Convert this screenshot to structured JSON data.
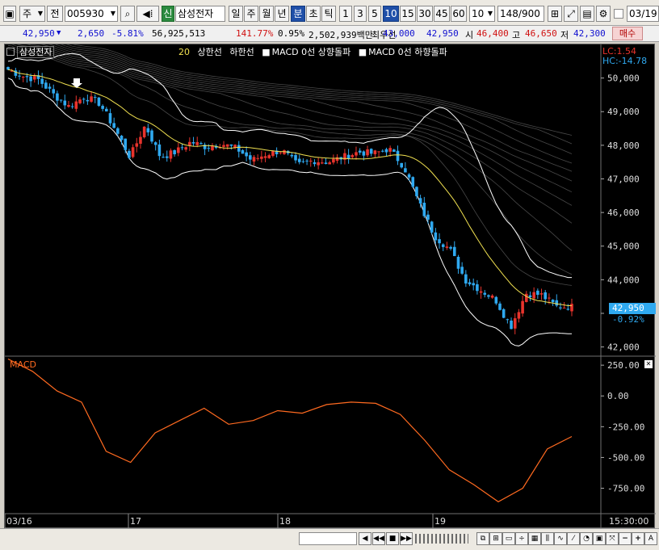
{
  "toolbar": {
    "period_select": "주",
    "prev_label": "전",
    "stock_code": "005930",
    "badge": "신",
    "stock_name": "삼성전자",
    "periods": [
      "일",
      "주",
      "월",
      "년",
      "분",
      "초",
      "틱"
    ],
    "active_period": "분",
    "intervals": [
      "1",
      "3",
      "5",
      "10",
      "15",
      "30",
      "45",
      "60"
    ],
    "active_interval": "10",
    "interval_select": "10",
    "count": "148",
    "total": "/900",
    "date": "03/19"
  },
  "infobar": {
    "price": "42,950",
    "change": "2,650",
    "change_pct": "-5.81%",
    "volume": "56,925,513",
    "vol_ratio": "141.77%",
    "turnover": "0.95%",
    "amount": "2,502,939백만",
    "label_best": "최우선",
    "ask": "43,000",
    "bid": "42,950",
    "open_label": "시",
    "open": "46,400",
    "high_label": "고",
    "high": "46,650",
    "low_label": "저",
    "low": "42,300",
    "buy_button": "매수"
  },
  "legend": {
    "stock_label": "삼성전자",
    "ma_text": "20",
    "upper": "상한선",
    "lower": "하한선",
    "macd_up": "MACD 0선 상향돌파",
    "macd_down": "MACD 0선 하향돌파",
    "lc": "LC:1.54",
    "hc": "HC:-14.78"
  },
  "price_axis": [
    "50,000",
    "49,000",
    "48,000",
    "47,000",
    "46,000",
    "45,000",
    "44,000",
    "43,000",
    "42,000"
  ],
  "current_price": "42,950",
  "current_pct": "-0.92%",
  "macd_panel": {
    "title": "MACD",
    "ticks": [
      "250.00",
      "0.00",
      "-250.00",
      "-500.00",
      "-750.00"
    ]
  },
  "time_axis": [
    "03/16",
    "17",
    "18",
    "19",
    "15:30:00"
  ],
  "colors": {
    "up": "#e8332c",
    "down": "#2fa9f0",
    "ma": "#f0e050",
    "band": "#ffffff",
    "macd": "#ff6a20",
    "blue_text": "#1010d0",
    "red_text": "#d01010"
  },
  "chart_data": {
    "type": "candlestick",
    "xlabel": "",
    "ylabel": "",
    "ylim": [
      41750,
      51000
    ],
    "time_labels": [
      "03/16",
      "17",
      "18",
      "19"
    ],
    "close_path": [
      50250,
      50050,
      49950,
      49500,
      49150,
      49450,
      49250,
      48500,
      47650,
      48600,
      47650,
      47800,
      48100,
      47950,
      48050,
      47900,
      47550,
      47750,
      47850,
      47400,
      47550,
      47500,
      47650,
      47800,
      47750,
      47900,
      47350,
      46250,
      45300,
      44900,
      44000,
      43700,
      43400,
      42600,
      43600,
      43550,
      43200,
      43200
    ],
    "macd_values": [
      300,
      200,
      40,
      -50,
      -450,
      -540,
      -300,
      -200,
      -100,
      -230,
      -200,
      -120,
      -140,
      -70,
      -50,
      -60,
      -150,
      -360,
      -600,
      -720,
      -860,
      -750,
      -430,
      -330
    ],
    "macd_ylim": [
      -950,
      310
    ]
  }
}
